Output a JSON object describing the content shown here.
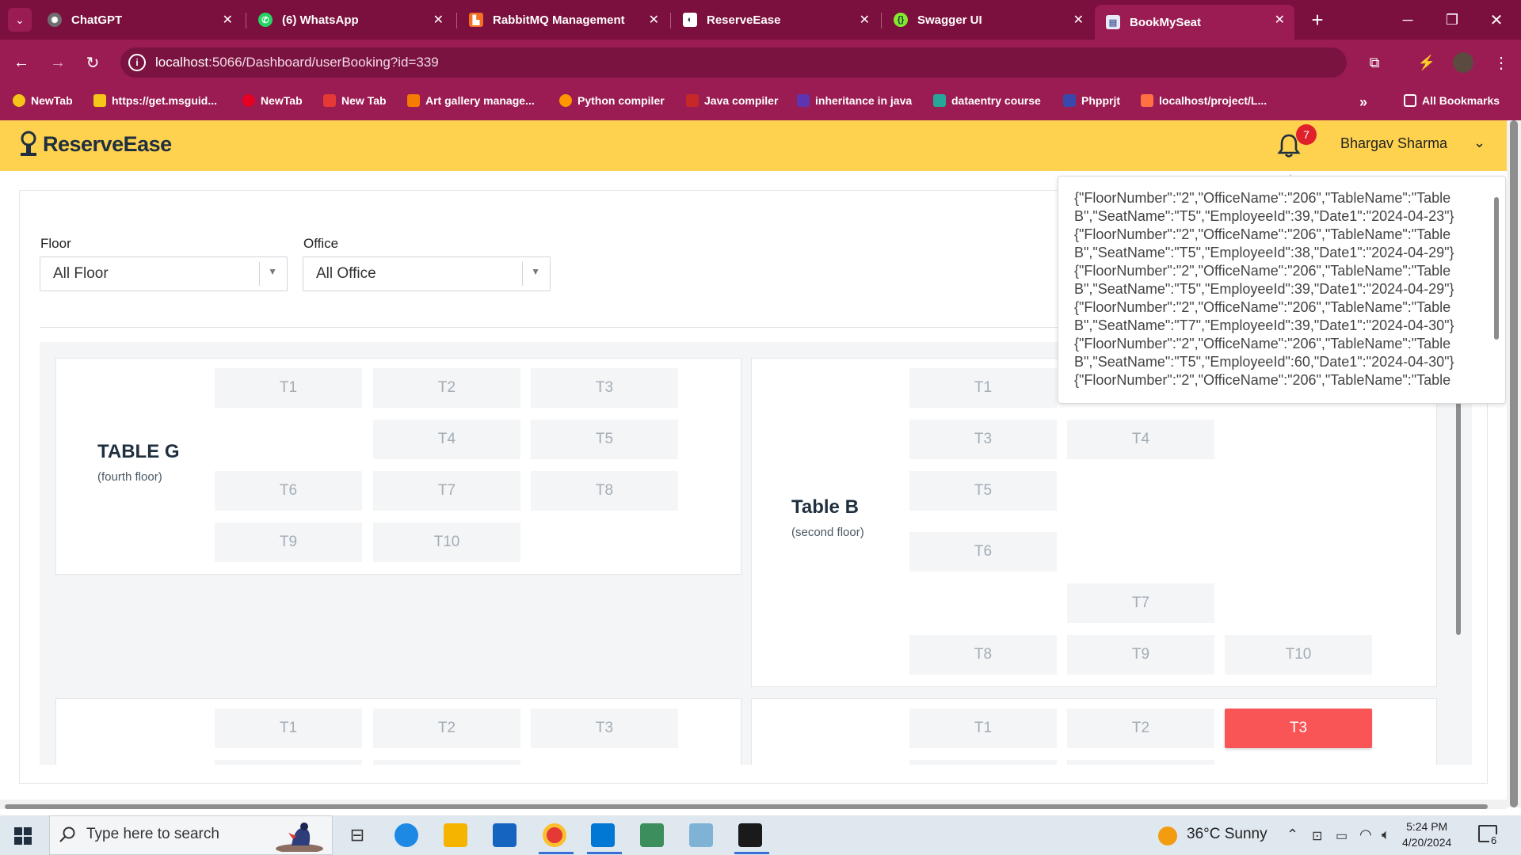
{
  "browser": {
    "tabs": [
      {
        "title": "ChatGPT",
        "color": "#7a7a7a"
      },
      {
        "title": "(6) WhatsApp",
        "color": "#25d366"
      },
      {
        "title": "RabbitMQ Management",
        "color": "#f36f21"
      },
      {
        "title": "ReserveEase",
        "color": "#ffffff"
      },
      {
        "title": "Swagger UI",
        "color": "#85ea2d"
      },
      {
        "title": "BookMySeat",
        "color": "#e8eaf6"
      }
    ],
    "url_host": "localhost",
    "url_rest": ":5066/Dashboard/userBooking?id=339",
    "bookmarks": [
      "NewTab",
      "https://get.msguid...",
      "NewTab",
      "New Tab",
      "Art gallery manage...",
      "Python compiler",
      "Java compiler",
      "inheritance in java",
      "dataentry course",
      "Phpprjt",
      "localhost/project/L..."
    ],
    "all_bookmarks": "All Bookmarks",
    "more_bookmarks": "»"
  },
  "app": {
    "logo": "ReserveEase",
    "notification_count": "7",
    "user_name": "Bhargav Sharma",
    "accent_color": "#fed24f"
  },
  "filters": {
    "floor_label": "Floor",
    "floor_value": "All Floor",
    "office_label": "Office",
    "office_value": "All Office"
  },
  "tables": [
    {
      "name": "TABLE G",
      "floor": "(fourth floor)",
      "seats": [
        "T1",
        "T2",
        "T3",
        "T4",
        "T5",
        "T6",
        "T7",
        "T8",
        "T9",
        "T10"
      ]
    },
    {
      "name": "Table B",
      "floor": "(second floor)",
      "seats": [
        "T1",
        "T3",
        "T4",
        "T5",
        "T6",
        "T7",
        "T8",
        "T9",
        "T10"
      ]
    },
    {
      "seats": [
        "T1",
        "T2",
        "T3"
      ]
    },
    {
      "seats": [
        "T1",
        "T2",
        "T3"
      ],
      "booked_seat": "T3"
    }
  ],
  "notification_popup": {
    "lines": [
      "{\"FloorNumber\":\"2\",\"OfficeName\":\"206\",\"TableName\":\"Table B\",\"SeatName\":\"T5\",\"EmployeeId\":39,\"Date1\":\"2024-04-23\"}",
      "{\"FloorNumber\":\"2\",\"OfficeName\":\"206\",\"TableName\":\"Table B\",\"SeatName\":\"T5\",\"EmployeeId\":38,\"Date1\":\"2024-04-29\"}",
      "{\"FloorNumber\":\"2\",\"OfficeName\":\"206\",\"TableName\":\"Table B\",\"SeatName\":\"T5\",\"EmployeeId\":39,\"Date1\":\"2024-04-29\"}",
      "{\"FloorNumber\":\"2\",\"OfficeName\":\"206\",\"TableName\":\"Table B\",\"SeatName\":\"T7\",\"EmployeeId\":39,\"Date1\":\"2024-04-30\"}",
      "{\"FloorNumber\":\"2\",\"OfficeName\":\"206\",\"TableName\":\"Table B\",\"SeatName\":\"T5\",\"EmployeeId\":60,\"Date1\":\"2024-04-30\"}",
      "{\"FloorNumber\":\"2\",\"OfficeName\":\"206\",\"TableName\":\"Table"
    ]
  },
  "taskbar": {
    "search_placeholder": "Type here to search",
    "weather": "36°C  Sunny",
    "time": "5:24 PM",
    "date": "4/20/2024",
    "notification_count": "6"
  }
}
